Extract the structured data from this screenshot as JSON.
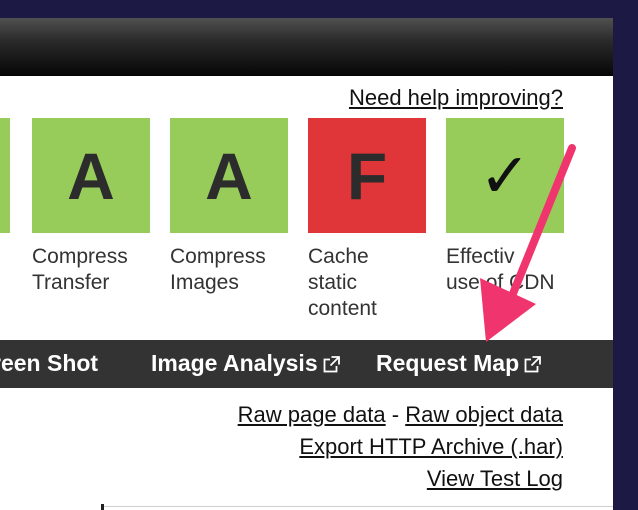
{
  "help": {
    "link_label": "Need help improving?"
  },
  "grades": [
    {
      "letter": "",
      "label": ""
    },
    {
      "letter": "A",
      "label_line1": "Compress",
      "label_line2": "Transfer"
    },
    {
      "letter": "A",
      "label_line1": "Compress",
      "label_line2": "Images"
    },
    {
      "letter": "F",
      "label_line1": "Cache",
      "label_line2": "static",
      "label_line3": "content"
    },
    {
      "letter": "✓",
      "label_line1": "Effectiv",
      "label_line2": "use of CDN"
    }
  ],
  "tabs": {
    "screen_shot": "reen Shot",
    "image_analysis": "Image Analysis",
    "request_map": "Request Map"
  },
  "links": {
    "raw_page_data": "Raw page data",
    "separator": "-",
    "raw_object_data": "Raw object data",
    "export_har": "Export HTTP Archive (.har)",
    "view_test_log": "View Test Log"
  },
  "colors": {
    "grade_green": "#97cc5b",
    "grade_red": "#e0363a",
    "annotation_arrow": "#f0356e",
    "tabbar": "#333333"
  }
}
